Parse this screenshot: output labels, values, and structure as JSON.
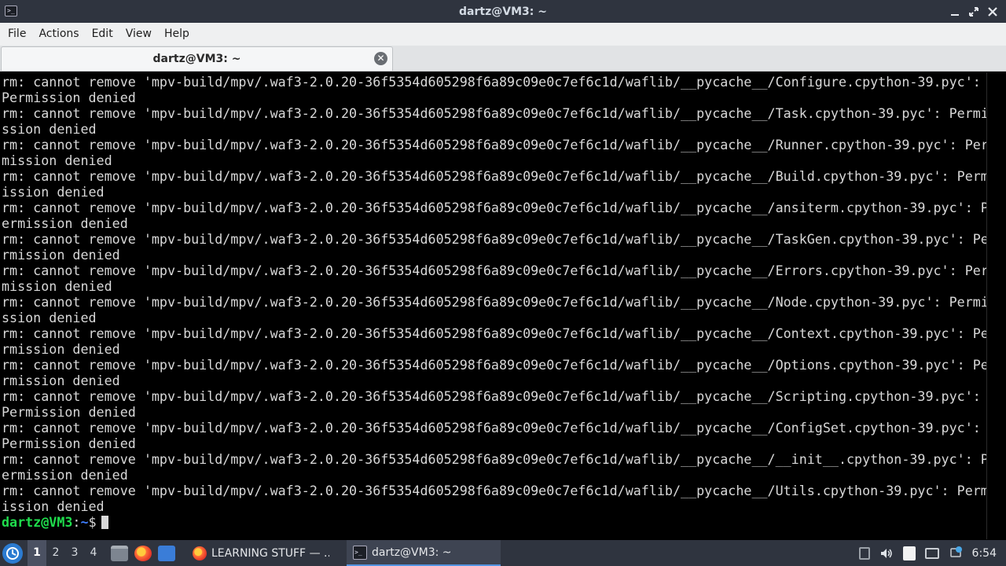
{
  "window": {
    "title": "dartz@VM3: ~",
    "app_icon": ">_"
  },
  "menu": [
    "File",
    "Actions",
    "Edit",
    "View",
    "Help"
  ],
  "tab": {
    "label": "dartz@VM3: ~",
    "close_symbol": "✕"
  },
  "terminal": {
    "lines": [
      "rm: cannot remove 'mpv-build/mpv/.waf3-2.0.20-36f5354d605298f6a89c09e0c7ef6c1d/waflib/__pycache__/Configure.cpython-39.pyc':",
      "Permission denied",
      "rm: cannot remove 'mpv-build/mpv/.waf3-2.0.20-36f5354d605298f6a89c09e0c7ef6c1d/waflib/__pycache__/Task.cpython-39.pyc': Permi",
      "ssion denied",
      "rm: cannot remove 'mpv-build/mpv/.waf3-2.0.20-36f5354d605298f6a89c09e0c7ef6c1d/waflib/__pycache__/Runner.cpython-39.pyc': Per",
      "mission denied",
      "rm: cannot remove 'mpv-build/mpv/.waf3-2.0.20-36f5354d605298f6a89c09e0c7ef6c1d/waflib/__pycache__/Build.cpython-39.pyc': Perm",
      "ission denied",
      "rm: cannot remove 'mpv-build/mpv/.waf3-2.0.20-36f5354d605298f6a89c09e0c7ef6c1d/waflib/__pycache__/ansiterm.cpython-39.pyc': P",
      "ermission denied",
      "rm: cannot remove 'mpv-build/mpv/.waf3-2.0.20-36f5354d605298f6a89c09e0c7ef6c1d/waflib/__pycache__/TaskGen.cpython-39.pyc': Pe",
      "rmission denied",
      "rm: cannot remove 'mpv-build/mpv/.waf3-2.0.20-36f5354d605298f6a89c09e0c7ef6c1d/waflib/__pycache__/Errors.cpython-39.pyc': Per",
      "mission denied",
      "rm: cannot remove 'mpv-build/mpv/.waf3-2.0.20-36f5354d605298f6a89c09e0c7ef6c1d/waflib/__pycache__/Node.cpython-39.pyc': Permi",
      "ssion denied",
      "rm: cannot remove 'mpv-build/mpv/.waf3-2.0.20-36f5354d605298f6a89c09e0c7ef6c1d/waflib/__pycache__/Context.cpython-39.pyc': Pe",
      "rmission denied",
      "rm: cannot remove 'mpv-build/mpv/.waf3-2.0.20-36f5354d605298f6a89c09e0c7ef6c1d/waflib/__pycache__/Options.cpython-39.pyc': Pe",
      "rmission denied",
      "rm: cannot remove 'mpv-build/mpv/.waf3-2.0.20-36f5354d605298f6a89c09e0c7ef6c1d/waflib/__pycache__/Scripting.cpython-39.pyc':",
      "Permission denied",
      "rm: cannot remove 'mpv-build/mpv/.waf3-2.0.20-36f5354d605298f6a89c09e0c7ef6c1d/waflib/__pycache__/ConfigSet.cpython-39.pyc':",
      "Permission denied",
      "rm: cannot remove 'mpv-build/mpv/.waf3-2.0.20-36f5354d605298f6a89c09e0c7ef6c1d/waflib/__pycache__/__init__.cpython-39.pyc': P",
      "ermission denied",
      "rm: cannot remove 'mpv-build/mpv/.waf3-2.0.20-36f5354d605298f6a89c09e0c7ef6c1d/waflib/__pycache__/Utils.cpython-39.pyc': Perm",
      "ission denied"
    ],
    "prompt_user": "dartz@VM3",
    "prompt_sep": ":",
    "prompt_path": "~",
    "prompt_symbol": "$"
  },
  "taskbar": {
    "workspaces": [
      "1",
      "2",
      "3",
      "4"
    ],
    "active_workspace": "1",
    "tasks": [
      {
        "label": "LEARNING STUFF — ...",
        "icon": "firefox-icon"
      },
      {
        "label": "dartz@VM3: ~",
        "icon": "terminal-icon"
      }
    ],
    "clock": "6:54"
  },
  "colors": {
    "prompt_user": "#1fdc4c",
    "prompt_path": "#3f7fff",
    "panel_bg": "#2f343f",
    "accent": "#5294e2"
  }
}
